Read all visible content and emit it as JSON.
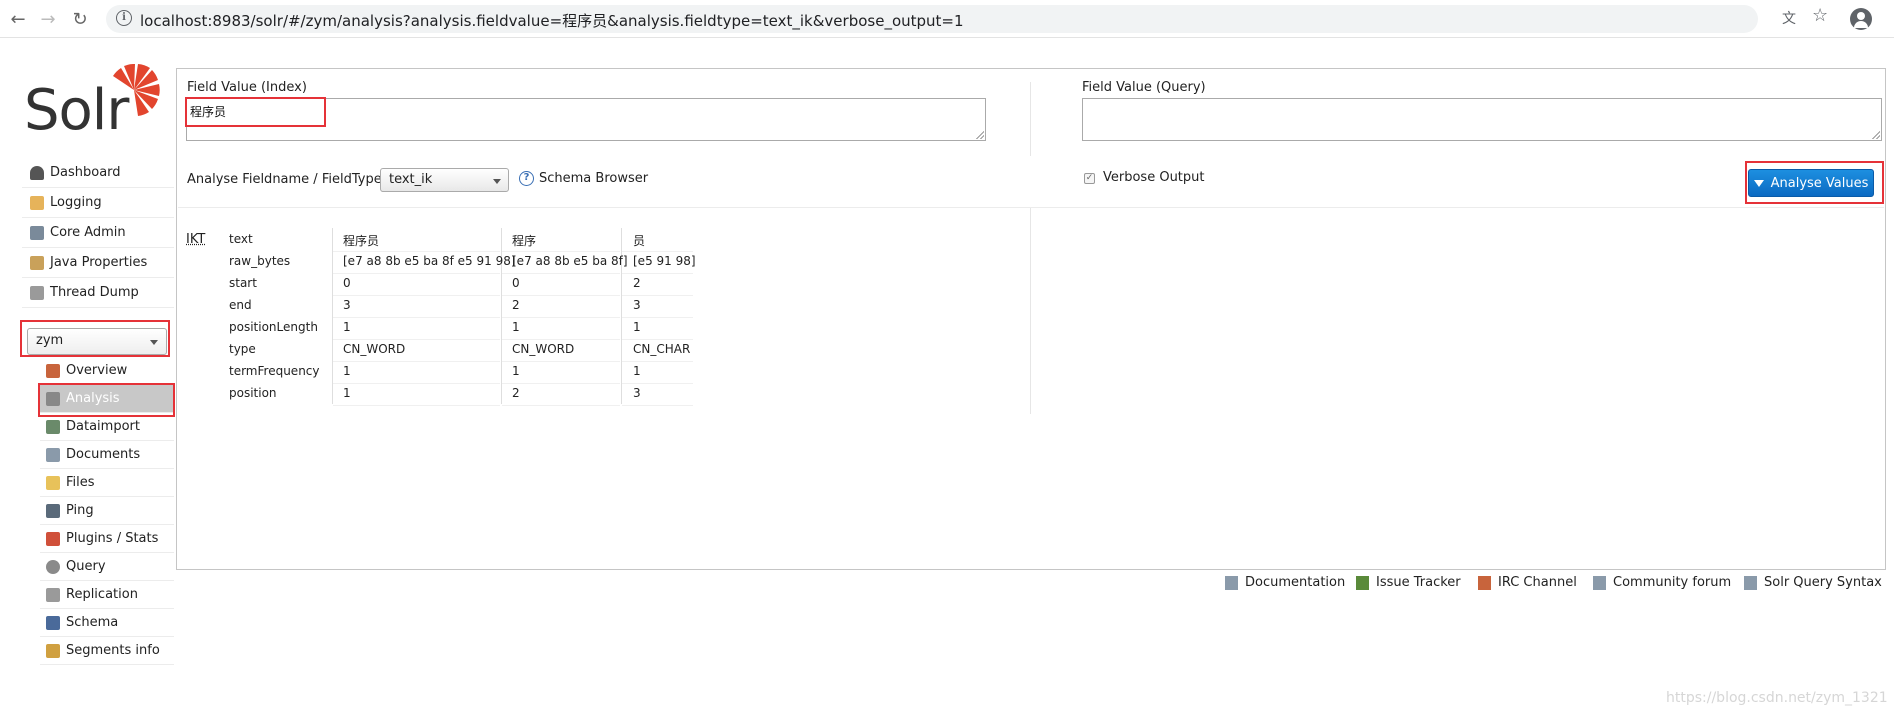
{
  "browser": {
    "back": "←",
    "forward": "→",
    "reload": "↻",
    "url": "localhost:8983/solr/#/zym/analysis?analysis.fieldvalue=程序员&analysis.fieldtype=text_ik&verbose_output=1",
    "translate": "文",
    "star": "☆"
  },
  "logo": {
    "text": "Solr"
  },
  "nav": {
    "main": [
      {
        "name": "dashboard",
        "label": "Dashboard",
        "color": "#555555"
      },
      {
        "name": "logging",
        "label": "Logging",
        "color": "#e6b35a"
      },
      {
        "name": "core-admin",
        "label": "Core Admin",
        "color": "#7a8a9a"
      },
      {
        "name": "java-properties",
        "label": "Java Properties",
        "color": "#c9a15a"
      },
      {
        "name": "thread-dump",
        "label": "Thread Dump",
        "color": "#9a9a9a"
      }
    ],
    "core_selector": {
      "selected": "zym"
    },
    "core": [
      {
        "name": "overview",
        "label": "Overview",
        "color": "#c8643c"
      },
      {
        "name": "analysis",
        "label": "Analysis",
        "color": "#888888",
        "active": true
      },
      {
        "name": "dataimport",
        "label": "Dataimport",
        "color": "#6a8a6a"
      },
      {
        "name": "documents",
        "label": "Documents",
        "color": "#8a9aaa"
      },
      {
        "name": "files",
        "label": "Files",
        "color": "#e8c25a"
      },
      {
        "name": "ping",
        "label": "Ping",
        "color": "#5a6a7a"
      },
      {
        "name": "plugins-stats",
        "label": "Plugins / Stats",
        "color": "#d0503a"
      },
      {
        "name": "query",
        "label": "Query",
        "color": "#8a8a8a"
      },
      {
        "name": "replication",
        "label": "Replication",
        "color": "#9a9a9a"
      },
      {
        "name": "schema",
        "label": "Schema",
        "color": "#4a6a9a"
      },
      {
        "name": "segments-info",
        "label": "Segments info",
        "color": "#d0a040"
      }
    ]
  },
  "analysis": {
    "index_label": "Field Value (Index)",
    "index_value": "程序员",
    "query_label": "Field Value (Query)",
    "query_value": "",
    "fieldtype_label": "Analyse Fieldname / FieldType:",
    "fieldtype_value": "text_ik",
    "schema_browser": "Schema Browser",
    "help_glyph": "?",
    "verbose_label": "Verbose Output",
    "verbose_checked": "✓",
    "analyse_button": "Analyse Values"
  },
  "tokens": {
    "tokenizer": "IKT",
    "rows": [
      "text",
      "raw_bytes",
      "start",
      "end",
      "positionLength",
      "type",
      "termFrequency",
      "position"
    ],
    "columns": [
      [
        "程序员",
        "[e7 a8 8b e5 ba 8f e5 91 98]",
        "0",
        "3",
        "1",
        "CN_WORD",
        "1",
        "1"
      ],
      [
        "程序",
        "[e7 a8 8b e5 ba 8f]",
        "0",
        "2",
        "1",
        "CN_WORD",
        "1",
        "2"
      ],
      [
        "员",
        "[e5 91 98]",
        "2",
        "3",
        "1",
        "CN_CHAR",
        "1",
        "3"
      ]
    ]
  },
  "footer": [
    {
      "name": "documentation",
      "label": "Documentation",
      "color": "#8a9aaa"
    },
    {
      "name": "issue-tracker",
      "label": "Issue Tracker",
      "color": "#5a8a3a"
    },
    {
      "name": "irc-channel",
      "label": "IRC Channel",
      "color": "#c8643c"
    },
    {
      "name": "community-forum",
      "label": "Community forum",
      "color": "#8a9aaa"
    },
    {
      "name": "solr-query-syntax",
      "label": "Solr Query Syntax",
      "color": "#8a9aaa"
    }
  ],
  "watermark": "https://blog.csdn.net/zym_1321",
  "colors": {
    "accent": "#0b6ac2",
    "highlight": "#e53238",
    "logo": "#e2452e"
  }
}
